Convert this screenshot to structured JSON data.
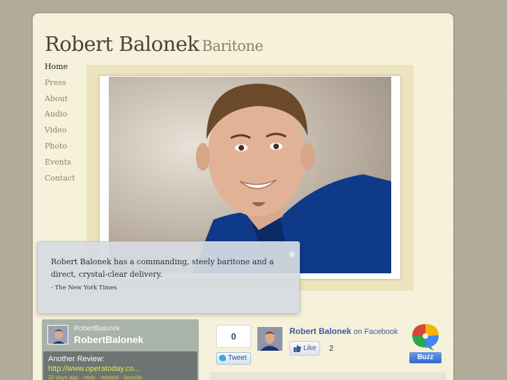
{
  "site": {
    "title": "Robert Balonek",
    "subtitle": "Baritone"
  },
  "nav": {
    "items": [
      "Home",
      "Press",
      "About",
      "Audio",
      "Video",
      "Photo",
      "Events",
      "Contact"
    ],
    "active": "Home"
  },
  "quote": {
    "text": "Robert Balonek has a commanding, steely baritone and a direct, crystal-clear delivery.",
    "source": "- The New York Times"
  },
  "twitter_widget": {
    "username_small": "RobertBalonek",
    "username_big": "RobertBalonek",
    "tweet_text": "Another Review:",
    "tweet_link": "http://www.operatoday.co...",
    "tweet_meta": "20 days ago · reply · retweet · favorite"
  },
  "tweet_button": {
    "count": "0",
    "label": "Tweet"
  },
  "facebook": {
    "name": "Robert Balonek",
    "suffix": "on Facebook",
    "like_label": "Like",
    "like_count": "2"
  },
  "buzz": {
    "label": "Buzz"
  },
  "colors": {
    "page_bg": "#b0aa98",
    "panel_bg": "#f6f1da",
    "frame": "#ede3bc",
    "facebook_blue": "#3b5998",
    "buzz_blue": "#3367c9"
  }
}
